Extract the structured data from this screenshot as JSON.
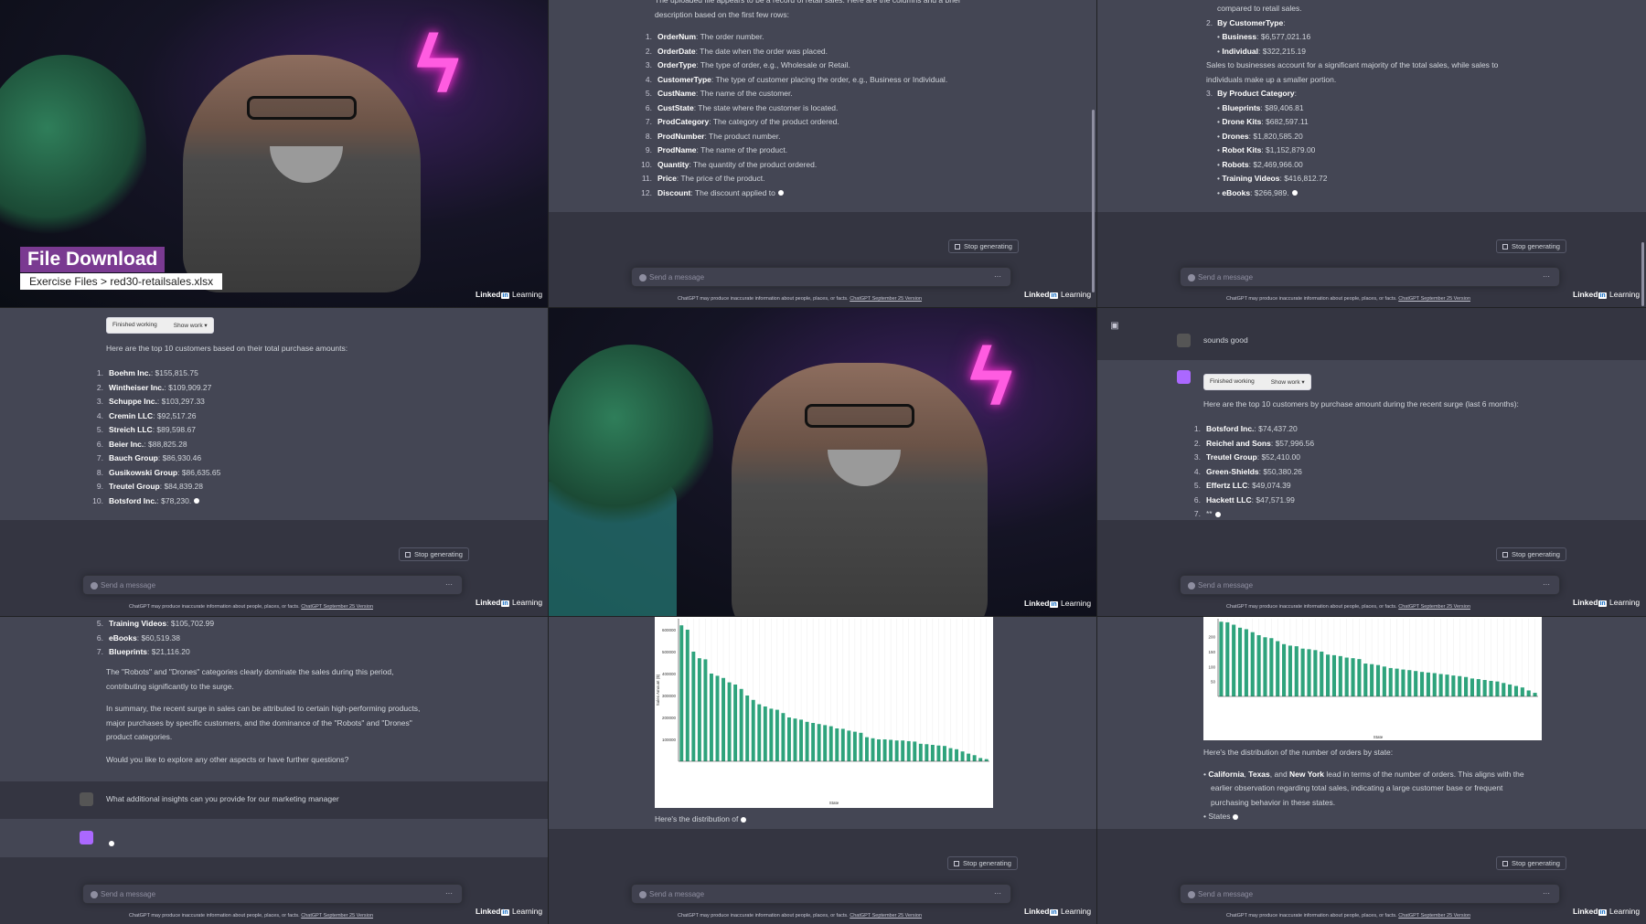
{
  "video": {
    "title": "File Download",
    "subtitle": "Exercise Files > red30-retailsales.xlsx",
    "brand_text": "Linked",
    "brand_in": "in",
    "brand_suffix": "Learning"
  },
  "common": {
    "stop_label": "Stop generating",
    "placeholder": "Send a message",
    "disclaimer": "ChatGPT may produce inaccurate information about people, places, or facts.",
    "disclaimer_link": "ChatGPT September 25 Version",
    "more": "···",
    "finished": "Finished working",
    "show_work": "Show work"
  },
  "panel_columns": {
    "intro": "The uploaded file appears to be a record of retail sales. Here are the columns and a brief",
    "intro2": "description based on the first few rows:",
    "items": [
      {
        "n": "1.",
        "k": "OrderNum",
        "v": ": The order number."
      },
      {
        "n": "2.",
        "k": "OrderDate",
        "v": ": The date when the order was placed."
      },
      {
        "n": "3.",
        "k": "OrderType",
        "v": ": The type of order, e.g., Wholesale or Retail."
      },
      {
        "n": "4.",
        "k": "CustomerType",
        "v": ": The type of customer placing the order, e.g., Business or Individual."
      },
      {
        "n": "5.",
        "k": "CustName",
        "v": ": The name of the customer."
      },
      {
        "n": "6.",
        "k": "CustState",
        "v": ": The state where the customer is located."
      },
      {
        "n": "7.",
        "k": "ProdCategory",
        "v": ": The category of the product ordered."
      },
      {
        "n": "8.",
        "k": "ProdNumber",
        "v": ": The product number."
      },
      {
        "n": "9.",
        "k": "ProdName",
        "v": ": The name of the product."
      },
      {
        "n": "10.",
        "k": "Quantity",
        "v": ": The quantity of the product ordered."
      },
      {
        "n": "11.",
        "k": "Price",
        "v": ": The price of the product."
      },
      {
        "n": "12.",
        "k": "Discount",
        "v": ": The discount applied to"
      }
    ]
  },
  "panel_breakdown": {
    "top": "compared to retail sales.",
    "h2": "2.",
    "h2_label": "By CustomerType",
    "ct": [
      {
        "k": "Business",
        "v": ": $6,577,021.16"
      },
      {
        "k": "Individual",
        "v": ": $322,215.19"
      }
    ],
    "note": "Sales to businesses account for a significant majority of the total sales, while sales to",
    "note2": "individuals make up a smaller portion.",
    "h3": "3.",
    "h3_label": "By Product Category",
    "pc": [
      {
        "k": "Blueprints",
        "v": ": $89,406.81"
      },
      {
        "k": "Drone Kits",
        "v": ": $682,597.11"
      },
      {
        "k": "Drones",
        "v": ": $1,820,585.20"
      },
      {
        "k": "Robot Kits",
        "v": ": $1,152,879.00"
      },
      {
        "k": "Robots",
        "v": ": $2,469,966.00"
      },
      {
        "k": "Training Videos",
        "v": ": $416,812.72"
      },
      {
        "k": "eBooks",
        "v": ": $266,989."
      }
    ]
  },
  "panel_top10": {
    "intro": "Here are the top 10 customers based on their total purchase amounts:",
    "items": [
      {
        "n": "1.",
        "k": "Boehm Inc.",
        "v": ": $155,815.75"
      },
      {
        "n": "2.",
        "k": "Wintheiser Inc.",
        "v": ": $109,909.27"
      },
      {
        "n": "3.",
        "k": "Schuppe Inc.",
        "v": ": $103,297.33"
      },
      {
        "n": "4.",
        "k": "Cremin LLC",
        "v": ": $92,517.26"
      },
      {
        "n": "5.",
        "k": "Streich LLC",
        "v": ": $89,598.67"
      },
      {
        "n": "6.",
        "k": "Beier Inc.",
        "v": ": $88,825.28"
      },
      {
        "n": "7.",
        "k": "Bauch Group",
        "v": ": $86,930.46"
      },
      {
        "n": "8.",
        "k": "Gusikowski Group",
        "v": ": $86,635.65"
      },
      {
        "n": "9.",
        "k": "Treutel Group",
        "v": ": $84,839.28"
      },
      {
        "n": "10.",
        "k": "Botsford Inc.",
        "v": ": $78,230."
      }
    ]
  },
  "panel_surge": {
    "user_msg": "sounds good",
    "intro": "Here are the top 10 customers by purchase amount during the recent surge (last 6 months):",
    "items": [
      {
        "n": "1.",
        "k": "Botsford Inc.",
        "v": ": $74,437.20"
      },
      {
        "n": "2.",
        "k": "Reichel and Sons",
        "v": ": $57,996.56"
      },
      {
        "n": "3.",
        "k": "Treutel Group",
        "v": ": $52,410.00"
      },
      {
        "n": "4.",
        "k": "Green-Shields",
        "v": ": $50,380.26"
      },
      {
        "n": "5.",
        "k": "Effertz LLC",
        "v": ": $49,074.39"
      },
      {
        "n": "6.",
        "k": "Hackett LLC",
        "v": ": $47,571.99"
      },
      {
        "n": "7.",
        "k": "",
        "v": "**"
      }
    ]
  },
  "panel_summary": {
    "items": [
      {
        "n": "5.",
        "k": "Training Videos",
        "v": ": $105,702.99"
      },
      {
        "n": "6.",
        "k": "eBooks",
        "v": ": $60,519.38"
      },
      {
        "n": "7.",
        "k": "Blueprints",
        "v": ": $21,116.20"
      }
    ],
    "p1": "The \"Robots\" and \"Drones\" categories clearly dominate the sales during this period,",
    "p1b": "contributing significantly to the surge.",
    "p2": "In summary, the recent surge in sales can be attributed to certain high-performing products,",
    "p2b": "major purchases by specific customers, and the dominance of the \"Robots\" and \"Drones\"",
    "p2c": "product categories.",
    "p3": "Would you like to explore any other aspects or have further questions?",
    "user_msg": "What additional insights can you provide for our marketing manager"
  },
  "panel_chart1": {
    "caption": "Here's the distribution of",
    "chart_data": {
      "type": "bar",
      "xlabel": "State",
      "ylabel": "Sales Amount ($)",
      "yticks": [
        "100000",
        "200000",
        "300000",
        "400000",
        "500000",
        "600000"
      ],
      "values": [
        620000,
        600000,
        500000,
        470000,
        465000,
        400000,
        390000,
        380000,
        360000,
        350000,
        330000,
        300000,
        280000,
        260000,
        250000,
        240000,
        235000,
        220000,
        200000,
        195000,
        190000,
        180000,
        175000,
        170000,
        165000,
        160000,
        150000,
        148000,
        140000,
        135000,
        130000,
        110000,
        105000,
        100000,
        100000,
        98000,
        95000,
        95000,
        92000,
        90000,
        80000,
        78000,
        75000,
        72000,
        70000,
        60000,
        55000,
        45000,
        35000,
        28000,
        15000,
        10000
      ]
    }
  },
  "panel_chart2": {
    "caption": "Here's the distribution of the number of orders by state:",
    "b1a": "California",
    "b1b": ", ",
    "b1c": "Texas",
    "b1d": ", and ",
    "b1e": "New York",
    "b1f": " lead in terms of the number of orders. This aligns with the",
    "b1g": "earlier observation regarding total sales, indicating a large customer base or frequent",
    "b1h": "purchasing behavior in these states.",
    "b2": "States",
    "chart_data": {
      "type": "bar",
      "xlabel": "State",
      "yticks": [
        "50",
        "100",
        "150",
        "200"
      ],
      "values": [
        250,
        248,
        240,
        230,
        225,
        215,
        205,
        198,
        195,
        185,
        175,
        170,
        168,
        160,
        158,
        155,
        150,
        140,
        138,
        135,
        130,
        128,
        125,
        110,
        108,
        105,
        100,
        95,
        93,
        90,
        88,
        85,
        82,
        80,
        78,
        75,
        73,
        70,
        68,
        65,
        60,
        58,
        55,
        52,
        50,
        45,
        40,
        35,
        30,
        20,
        12
      ]
    }
  }
}
